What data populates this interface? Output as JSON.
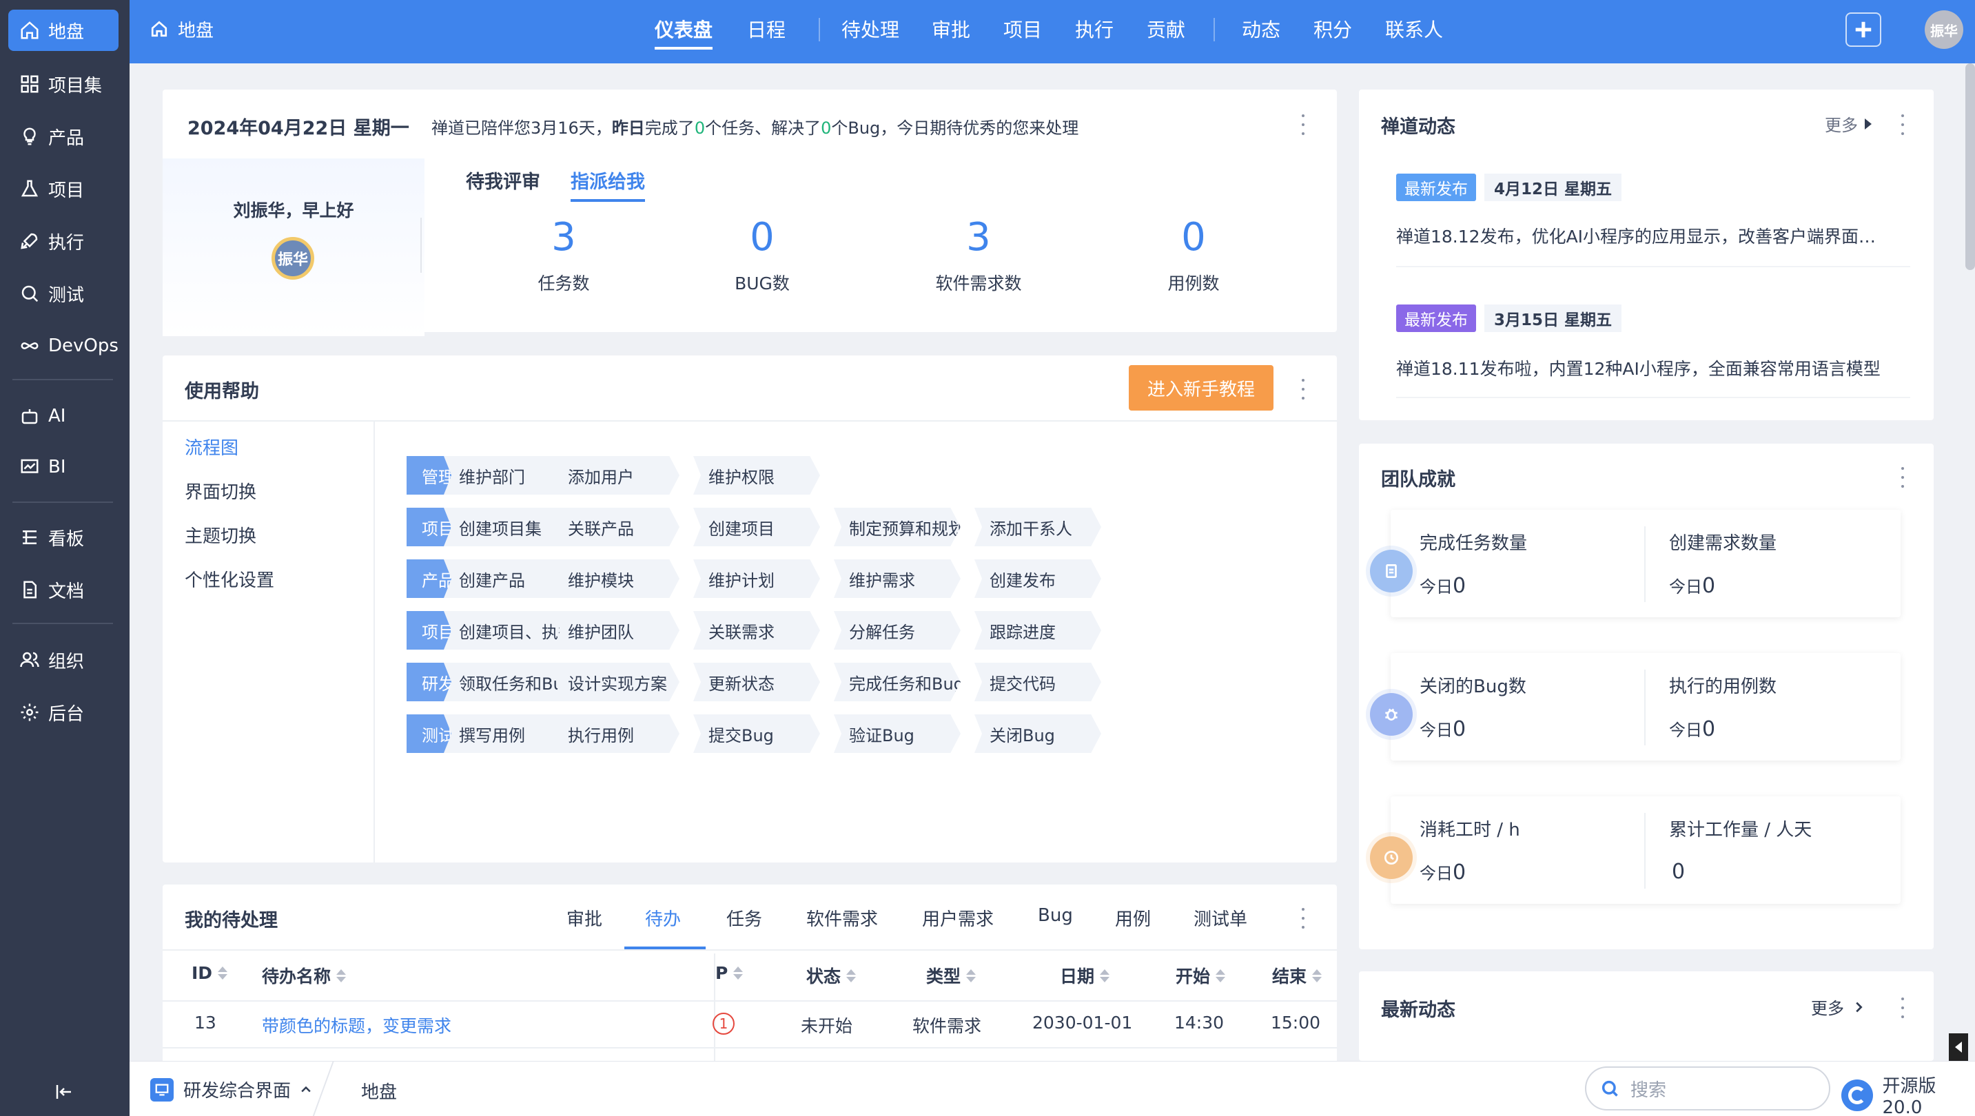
{
  "sidebar": {
    "items": [
      {
        "label": "地盘",
        "icon": "home-icon"
      },
      {
        "label": "项目集",
        "icon": "grid-icon"
      },
      {
        "label": "产品",
        "icon": "lightbulb-icon"
      },
      {
        "label": "项目",
        "icon": "flask-icon"
      },
      {
        "label": "执行",
        "icon": "rocket-icon"
      },
      {
        "label": "测试",
        "icon": "search-icon"
      },
      {
        "label": "DevOps",
        "icon": "infinity-icon"
      },
      {
        "label": "AI",
        "icon": "robot-icon"
      },
      {
        "label": "BI",
        "icon": "chart-icon"
      },
      {
        "label": "看板",
        "icon": "board-icon"
      },
      {
        "label": "文档",
        "icon": "doc-icon"
      },
      {
        "label": "组织",
        "icon": "users-icon"
      },
      {
        "label": "后台",
        "icon": "gear-icon"
      }
    ]
  },
  "topbar": {
    "crumb": "地盘",
    "nav": [
      "仪表盘",
      "日程",
      "待处理",
      "审批",
      "项目",
      "执行",
      "贡献",
      "动态",
      "积分",
      "联系人"
    ],
    "avatar": "振华"
  },
  "welcome": {
    "date": "2024年04月22日 星期一",
    "msg_pre": "禅道已陪伴您3月16天，",
    "msg_bold": "昨日",
    "msg_mid1": "完成了",
    "msg_n1": "0",
    "msg_mid2": "个任务、解决了",
    "msg_n2": "0",
    "msg_post": "个Bug，今日期待优秀的您来处理",
    "greeting": "刘振华，早上好",
    "avatar": "振华",
    "tabs": [
      "待我评审",
      "指派给我"
    ],
    "stats": [
      {
        "value": "3",
        "label": "任务数"
      },
      {
        "value": "0",
        "label": "BUG数"
      },
      {
        "value": "3",
        "label": "软件需求数"
      },
      {
        "value": "0",
        "label": "用例数"
      }
    ]
  },
  "help": {
    "title": "使用帮助",
    "button": "进入新手教程",
    "menu": [
      "流程图",
      "界面切换",
      "主题切换",
      "个性化设置"
    ],
    "flows": [
      {
        "role": "管理员",
        "steps": [
          "维护部门",
          "添加用户",
          "维护权限"
        ]
      },
      {
        "role": "项目集负责人",
        "steps": [
          "创建项目集",
          "关联产品",
          "创建项目",
          "制定预算和规划",
          "添加干系人"
        ]
      },
      {
        "role": "产品经理",
        "steps": [
          "创建产品",
          "维护模块",
          "维护计划",
          "维护需求",
          "创建发布"
        ]
      },
      {
        "role": "项目经理",
        "steps": [
          "创建项目、执行",
          "维护团队",
          "关联需求",
          "分解任务",
          "跟踪进度"
        ]
      },
      {
        "role": "研发人员",
        "steps": [
          "领取任务和Bug",
          "设计实现方案",
          "更新状态",
          "完成任务和Bug",
          "提交代码"
        ]
      },
      {
        "role": "测试人员",
        "steps": [
          "撰写用例",
          "执行用例",
          "提交Bug",
          "验证Bug",
          "关闭Bug"
        ]
      }
    ]
  },
  "todo": {
    "title": "我的待处理",
    "tabs": [
      "审批",
      "待办",
      "任务",
      "软件需求",
      "用户需求",
      "Bug",
      "用例",
      "测试单"
    ],
    "columns": [
      "ID",
      "待办名称",
      "P",
      "状态",
      "类型",
      "日期",
      "开始",
      "结束"
    ],
    "rows": [
      {
        "id": "13",
        "name": "带颜色的标题，变更需求",
        "p": "1",
        "status": "未开始",
        "type": "软件需求",
        "date": "2030-01-01",
        "start": "14:30",
        "end": "15:00"
      }
    ]
  },
  "news": {
    "title": "禅道动态",
    "more": "更多",
    "items": [
      {
        "badge": "最新发布",
        "date": "4月12日 星期五",
        "text": "禅道18.12发布，优化AI小程序的应用显示，改善客户端界面…",
        "color": "#5aa0f5"
      },
      {
        "badge": "最新发布",
        "date": "3月15日 星期五",
        "text": "禅道18.11发布啦，内置12种AI小程序，全面兼容常用语言模型",
        "color": "#8a68e8"
      }
    ]
  },
  "achievement": {
    "title": "团队成就",
    "today_label": "今日",
    "rows": [
      {
        "icon": "clipboard-icon",
        "color": "#9fc0f2",
        "left": {
          "label": "完成任务数量",
          "value": "0"
        },
        "right": {
          "label": "创建需求数量",
          "value": "0"
        }
      },
      {
        "icon": "bug-icon",
        "color": "#9fb7f2",
        "left": {
          "label": "关闭的Bug数",
          "value": "0"
        },
        "right": {
          "label": "执行的用例数",
          "value": "0"
        }
      },
      {
        "icon": "clock-icon",
        "color": "#f4c28c",
        "left": {
          "label": "消耗工时 / h",
          "value": "0"
        },
        "right": {
          "label": "累计工作量 / 人天",
          "value": "0"
        }
      }
    ]
  },
  "latest": {
    "title": "最新动态",
    "more": "更多"
  },
  "bottombar": {
    "app": "研发综合界面",
    "crumb": "地盘",
    "search_placeholder": "搜索",
    "version": "开源版20.0"
  }
}
